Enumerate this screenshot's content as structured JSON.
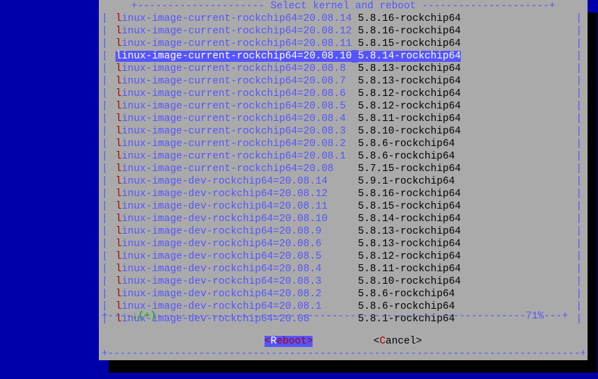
{
  "title": "Select kernel and reboot",
  "percent": "71%",
  "buttons": {
    "reboot": {
      "hot": "R",
      "rest": "eboot"
    },
    "cancel": {
      "hot": "C",
      "rest": "ancel"
    }
  },
  "kernels": [
    {
      "pkg": "linux-image-current-rockchip64=20.08.14",
      "ver": "5.8.16-rockchip64",
      "sel": false
    },
    {
      "pkg": "linux-image-current-rockchip64=20.08.12",
      "ver": "5.8.16-rockchip64",
      "sel": false
    },
    {
      "pkg": "linux-image-current-rockchip64=20.08.11",
      "ver": "5.8.15-rockchip64",
      "sel": false
    },
    {
      "pkg": "linux-image-current-rockchip64=20.08.10",
      "ver": "5.8.14-rockchip64",
      "sel": true
    },
    {
      "pkg": "linux-image-current-rockchip64=20.08.8",
      "ver": "5.8.13-rockchip64",
      "sel": false
    },
    {
      "pkg": "linux-image-current-rockchip64=20.08.7",
      "ver": "5.8.13-rockchip64",
      "sel": false
    },
    {
      "pkg": "linux-image-current-rockchip64=20.08.6",
      "ver": "5.8.12-rockchip64",
      "sel": false
    },
    {
      "pkg": "linux-image-current-rockchip64=20.08.5",
      "ver": "5.8.12-rockchip64",
      "sel": false
    },
    {
      "pkg": "linux-image-current-rockchip64=20.08.4",
      "ver": "5.8.11-rockchip64",
      "sel": false
    },
    {
      "pkg": "linux-image-current-rockchip64=20.08.3",
      "ver": "5.8.10-rockchip64",
      "sel": false
    },
    {
      "pkg": "linux-image-current-rockchip64=20.08.2",
      "ver": "5.8.6-rockchip64",
      "sel": false
    },
    {
      "pkg": "linux-image-current-rockchip64=20.08.1",
      "ver": "5.8.6-rockchip64",
      "sel": false
    },
    {
      "pkg": "linux-image-current-rockchip64=20.08",
      "ver": "5.7.15-rockchip64",
      "sel": false
    },
    {
      "pkg": "linux-image-dev-rockchip64=20.08.14",
      "ver": "5.9.1-rockchip64",
      "sel": false
    },
    {
      "pkg": "linux-image-dev-rockchip64=20.08.12",
      "ver": "5.8.16-rockchip64",
      "sel": false
    },
    {
      "pkg": "linux-image-dev-rockchip64=20.08.11",
      "ver": "5.8.15-rockchip64",
      "sel": false
    },
    {
      "pkg": "linux-image-dev-rockchip64=20.08.10",
      "ver": "5.8.14-rockchip64",
      "sel": false
    },
    {
      "pkg": "linux-image-dev-rockchip64=20.08.9",
      "ver": "5.8.13-rockchip64",
      "sel": false
    },
    {
      "pkg": "linux-image-dev-rockchip64=20.08.6",
      "ver": "5.8.13-rockchip64",
      "sel": false
    },
    {
      "pkg": "linux-image-dev-rockchip64=20.08.5",
      "ver": "5.8.12-rockchip64",
      "sel": false
    },
    {
      "pkg": "linux-image-dev-rockchip64=20.08.4",
      "ver": "5.8.11-rockchip64",
      "sel": false
    },
    {
      "pkg": "linux-image-dev-rockchip64=20.08.3",
      "ver": "5.8.10-rockchip64",
      "sel": false
    },
    {
      "pkg": "linux-image-dev-rockchip64=20.08.2",
      "ver": "5.8.6-rockchip64",
      "sel": false
    },
    {
      "pkg": "linux-image-dev-rockchip64=20.08.1",
      "ver": "5.8.6-rockchip64",
      "sel": false
    },
    {
      "pkg": "linux-image-dev-rockchip64=20.08",
      "ver": "5.8.1-rockchip64",
      "sel": false
    }
  ]
}
